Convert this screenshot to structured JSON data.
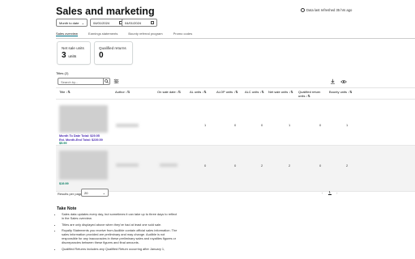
{
  "page": {
    "title": "Sales and marketing",
    "refresh_text": "Data last refreshed 35 hrs ago"
  },
  "filters": {
    "period": "Month to date",
    "start_date": "04/01/2024",
    "end_date": "04/01/2024",
    "separator": "-"
  },
  "tabs": [
    {
      "label": "Sales overview",
      "active": true
    },
    {
      "label": "Earnings statements",
      "active": false
    },
    {
      "label": "Bounty referral program",
      "active": false
    },
    {
      "label": "Promo codes",
      "active": false
    }
  ],
  "summary_cards": [
    {
      "label": "Net sale units",
      "value": "3",
      "unit": "units"
    },
    {
      "label": "Qualified returns",
      "value": "0",
      "unit": ""
    }
  ],
  "table": {
    "count_label": "Titles (2)",
    "search_placeholder": "Search by...",
    "columns": [
      "Title ↓⇅",
      "Author ↓⇅",
      "On sale date ↓⇅",
      "AL units ↓⇅",
      "ALOP units ↓⇅",
      "ALC units ↓⇅",
      "Net sale units ↓⇅",
      "Qualified return units ↓⇅",
      "Bounty units ↓⇅"
    ],
    "rows": [
      {
        "mtd_total": "Month To Date Total: $29.95",
        "eom_total": "Est. Month-End Total: $239.59",
        "price": "$5.99",
        "values": [
          "1",
          "0",
          "0",
          "1",
          "0",
          "1"
        ]
      },
      {
        "mtd_total": "",
        "eom_total": "",
        "price": "$19.99",
        "values": [
          "0",
          "0",
          "2",
          "2",
          "0",
          "2"
        ]
      }
    ]
  },
  "pagination": {
    "results_label": "Results per page",
    "results_value": "20",
    "prev": "‹",
    "current": "1",
    "next": "›"
  },
  "notes": {
    "title": "Take Note",
    "items": [
      "Sales data updates every day, but sometimes it can take up to three days to reflect in the Sales overview.",
      "Titles are only displayed above when they've had at least one sold sale.",
      "Royalty Statements you receive from Audible contain official sales information. The sales information provided are preliminary and may change. Audible is not responsible for any inaccuracies in these preliminary sales and royalties figures or discrepancies between these figures and final amounts.",
      "Qualified Returns includes any Qualified Return occurring after January 1,"
    ]
  },
  "icons": [
    "info-icon",
    "calendar-icon",
    "chevron-down-icon",
    "search-icon",
    "filter-icon",
    "download-icon",
    "eye-icon"
  ]
}
